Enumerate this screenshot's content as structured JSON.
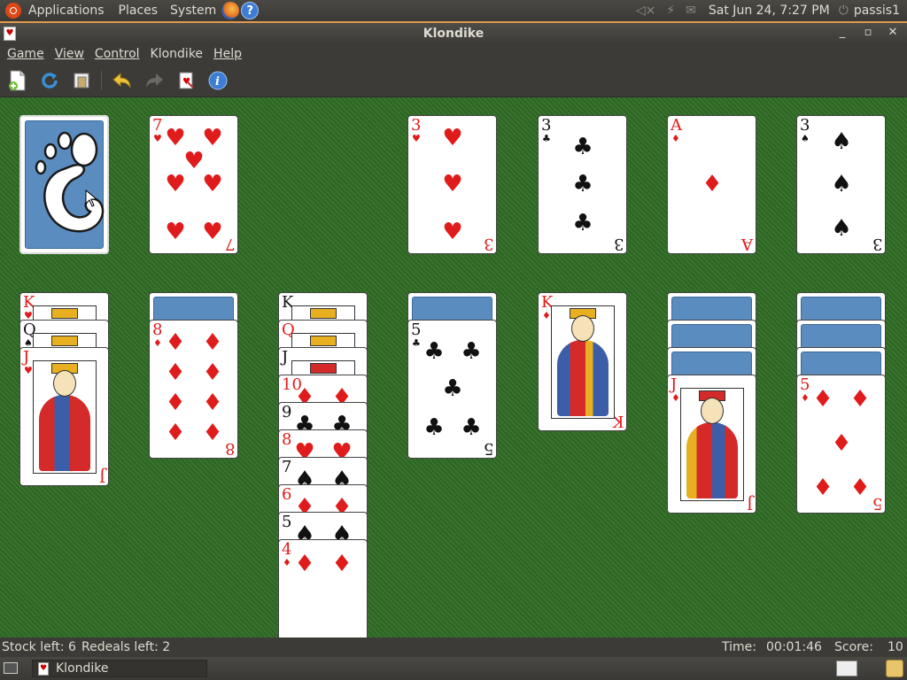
{
  "top_panel": {
    "applications": "Applications",
    "places": "Places",
    "system": "System",
    "datetime": "Sat Jun 24,  7:27 PM",
    "user": "passis1"
  },
  "window": {
    "title": "Klondike"
  },
  "menubar": {
    "game": "Game",
    "view": "View",
    "control": "Control",
    "klondike": "Klondike",
    "help": "Help"
  },
  "toolbar": {
    "icons": [
      "new-game-icon",
      "restart-icon",
      "select-game-icon",
      "undo-icon",
      "redo-icon",
      "hint-icon",
      "info-icon"
    ]
  },
  "colors": {
    "felt": "#2f6a24",
    "card_back": "#5b8cbf",
    "red_suit": "#e01b1b",
    "panel": "#3c3b37"
  },
  "board": {
    "stock": {
      "face": "back"
    },
    "waste": {
      "rank": "7",
      "suit": "♥",
      "color": "red"
    },
    "foundations": [
      {
        "rank": "3",
        "suit": "♥",
        "color": "red"
      },
      {
        "rank": "3",
        "suit": "♣",
        "color": "black"
      },
      {
        "rank": "A",
        "suit": "♦",
        "color": "red"
      },
      {
        "rank": "3",
        "suit": "♠",
        "color": "black"
      }
    ],
    "tableau": [
      {
        "hidden": 0,
        "cards": [
          {
            "rank": "K",
            "suit": "♥",
            "color": "red"
          },
          {
            "rank": "Q",
            "suit": "♠",
            "color": "black"
          },
          {
            "rank": "J",
            "suit": "♥",
            "color": "red"
          }
        ]
      },
      {
        "hidden": 1,
        "cards": [
          {
            "rank": "8",
            "suit": "♦",
            "color": "red"
          }
        ]
      },
      {
        "hidden": 0,
        "cards": [
          {
            "rank": "K",
            "suit": "♠",
            "color": "black"
          },
          {
            "rank": "Q",
            "suit": "♦",
            "color": "red"
          },
          {
            "rank": "J",
            "suit": "♠",
            "color": "black"
          },
          {
            "rank": "10",
            "suit": "♦",
            "color": "red"
          },
          {
            "rank": "9",
            "suit": "♣",
            "color": "black"
          },
          {
            "rank": "8",
            "suit": "♥",
            "color": "red"
          },
          {
            "rank": "7",
            "suit": "♠",
            "color": "black"
          },
          {
            "rank": "6",
            "suit": "♦",
            "color": "red"
          },
          {
            "rank": "5",
            "suit": "♠",
            "color": "black"
          },
          {
            "rank": "4",
            "suit": "♦",
            "color": "red"
          }
        ]
      },
      {
        "hidden": 1,
        "cards": [
          {
            "rank": "5",
            "suit": "♣",
            "color": "black"
          }
        ]
      },
      {
        "hidden": 0,
        "cards": [
          {
            "rank": "K",
            "suit": "♦",
            "color": "red"
          }
        ]
      },
      {
        "hidden": 3,
        "cards": [
          {
            "rank": "J",
            "suit": "♦",
            "color": "red"
          }
        ]
      },
      {
        "hidden": 3,
        "cards": [
          {
            "rank": "5",
            "suit": "♦",
            "color": "red"
          }
        ]
      }
    ]
  },
  "status": {
    "stock_left": "Stock left: 6",
    "redeals_left": "Redeals left: 2",
    "time_label": "Time:",
    "time_value": "00:01:46",
    "score_label": "Score:",
    "score_value": "10"
  },
  "bottom_panel": {
    "task": "Klondike"
  }
}
